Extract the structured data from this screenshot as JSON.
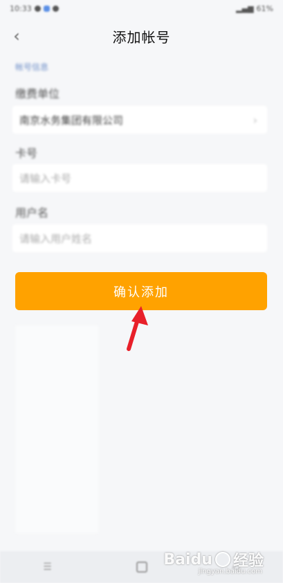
{
  "status_bar": {
    "time": "10:33",
    "battery": "61%"
  },
  "header": {
    "back_glyph": "‹",
    "title": "添加帐号"
  },
  "form": {
    "section_label": "帐号信息",
    "fields": [
      {
        "label": "缴费单位",
        "value": "南京水务集团有限公司",
        "has_chevron": true
      },
      {
        "label": "卡号",
        "placeholder": "请输入卡号"
      },
      {
        "label": "用户名",
        "placeholder": "请输入用户姓名"
      }
    ]
  },
  "confirm_button": {
    "label": "确认添加",
    "color": "#ffa200"
  },
  "annotation": {
    "arrow_color": "#e8202a"
  },
  "watermark": {
    "brand": "Baidu",
    "suffix": "经验",
    "sub": "jingyan.baidu.com"
  },
  "icons": {
    "back": "chevron-left-icon",
    "chevron": "chevron-right-icon",
    "menu": "menu-icon",
    "home": "home-icon"
  }
}
